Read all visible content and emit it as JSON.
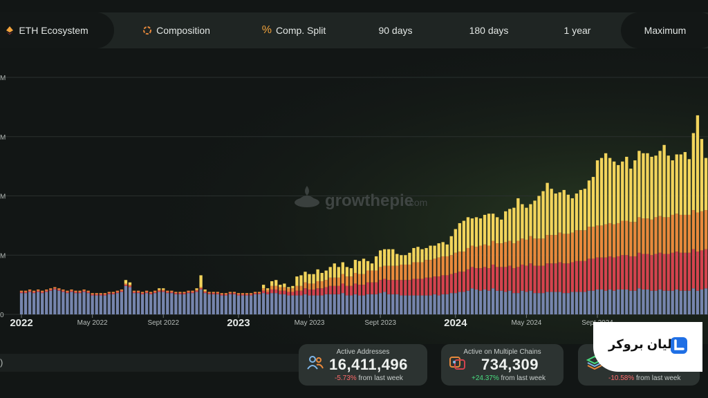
{
  "tabs": [
    {
      "label": "ETH Ecosystem",
      "icon": "eth-ecosystem-icon"
    },
    {
      "label": "Composition",
      "icon": "composition-icon"
    },
    {
      "label": "Comp. Split",
      "icon": "percent-icon"
    },
    {
      "label": "90 days"
    },
    {
      "label": "180 days"
    },
    {
      "label": "1 year"
    },
    {
      "label": "Maximum",
      "active": true
    }
  ],
  "watermark": {
    "text": "growthepie",
    "suffix": ".com",
    "icon": "pie-logo-icon"
  },
  "stats": [
    {
      "title": "Active Addresses",
      "value": "16,411,496",
      "change": "-5.73%",
      "direction": "down",
      "suffix": "from last week",
      "icon": "users-icon"
    },
    {
      "title": "Active on Multiple Chains",
      "value": "734,309",
      "change": "+24.37%",
      "direction": "up",
      "suffix": "from last week",
      "icon": "chains-icon"
    },
    {
      "title": "",
      "value": "",
      "change": "-10.58%",
      "direction": "down",
      "suffix": "from last week",
      "icon": "layers-icon"
    }
  ],
  "bottom_label": ")",
  "brand": {
    "label": "لیان بروکر",
    "icon": "brand-logo-icon"
  },
  "colors": {
    "accent_yellow": "#f2d45c",
    "mid_orange": "#e8893c",
    "red": "#d4434e",
    "blue_gray": "#7685ad",
    "background": "#121615",
    "up": "#4ade80",
    "down": "#ff6a6a"
  },
  "chart_data": {
    "type": "bar",
    "stacked": true,
    "y_tick_suffix": "M",
    "y_tick_labels": [
      "M",
      "M",
      "M",
      "M",
      "0"
    ],
    "ylim": [
      0,
      20
    ],
    "grid": true,
    "x_tick_labels": [
      "2022",
      "May 2022",
      "Sept 2022",
      "2023",
      "May 2023",
      "Sept 2023",
      "2024",
      "May 2024",
      "Sept 2024"
    ],
    "x_tick_bold": [
      "2022",
      "2023",
      "2024"
    ],
    "x_tick_index": [
      0,
      17,
      34,
      52,
      69,
      86,
      104,
      121,
      138
    ],
    "series": [
      {
        "color": "#7685ad",
        "values": [
          1.8,
          1.8,
          1.9,
          1.8,
          1.9,
          1.8,
          1.9,
          2.0,
          2.1,
          2.0,
          1.9,
          1.8,
          1.9,
          1.8,
          1.8,
          1.9,
          1.8,
          1.6,
          1.6,
          1.6,
          1.6,
          1.7,
          1.7,
          1.8,
          1.9,
          2.4,
          2.3,
          1.8,
          1.8,
          1.7,
          1.8,
          1.7,
          1.8,
          1.9,
          1.9,
          1.8,
          1.8,
          1.7,
          1.7,
          1.7,
          1.8,
          1.8,
          1.9,
          2.1,
          1.8,
          1.7,
          1.7,
          1.7,
          1.6,
          1.6,
          1.7,
          1.7,
          1.6,
          1.6,
          1.6,
          1.6,
          1.7,
          1.7,
          1.8,
          1.7,
          1.8,
          1.8,
          1.7,
          1.7,
          1.6,
          1.6,
          1.6,
          1.6,
          1.7,
          1.6,
          1.6,
          1.6,
          1.6,
          1.7,
          1.7,
          1.7,
          1.7,
          1.8,
          1.6,
          1.6,
          1.7,
          1.6,
          1.6,
          1.7,
          1.7,
          1.7,
          1.8,
          1.9,
          1.7,
          1.7,
          1.7,
          1.6,
          1.6,
          1.6,
          1.6,
          1.6,
          1.6,
          1.6,
          1.6,
          1.7,
          1.6,
          1.7,
          1.7,
          1.8,
          1.8,
          1.9,
          1.9,
          2.0,
          2.2,
          2.1,
          2.0,
          2.1,
          2.0,
          2.2,
          2.0,
          2.0,
          1.9,
          2.0,
          1.8,
          1.8,
          2.0,
          1.9,
          2.0,
          1.8,
          1.8,
          1.8,
          1.9,
          1.9,
          1.9,
          1.9,
          1.8,
          1.8,
          1.9,
          1.9,
          1.9,
          1.9,
          2.0,
          2.0,
          2.1,
          2.1,
          2.0,
          2.1,
          2.0,
          2.1,
          2.1,
          2.1,
          2.0,
          2.0,
          2.2,
          2.1,
          2.1,
          2.0,
          2.0,
          2.1,
          2.0,
          2.0,
          2.0,
          2.1,
          2.0,
          2.0,
          2.0,
          2.2,
          2.0,
          2.1,
          2.2
        ]
      },
      {
        "color": "#d4434e",
        "values": [
          0.1,
          0.1,
          0.1,
          0.1,
          0.1,
          0.1,
          0.1,
          0.1,
          0.1,
          0.1,
          0.1,
          0.1,
          0.1,
          0.1,
          0.1,
          0.1,
          0.1,
          0.1,
          0.1,
          0.1,
          0.1,
          0.1,
          0.1,
          0.1,
          0.1,
          0.1,
          0.1,
          0.1,
          0.1,
          0.1,
          0.1,
          0.1,
          0.1,
          0.1,
          0.1,
          0.1,
          0.1,
          0.1,
          0.1,
          0.1,
          0.1,
          0.1,
          0.1,
          0.1,
          0.1,
          0.1,
          0.1,
          0.1,
          0.1,
          0.1,
          0.1,
          0.1,
          0.1,
          0.1,
          0.1,
          0.1,
          0.1,
          0.1,
          0.2,
          0.2,
          0.3,
          0.3,
          0.3,
          0.3,
          0.3,
          0.3,
          0.4,
          0.4,
          0.5,
          0.5,
          0.5,
          0.6,
          0.6,
          0.6,
          0.7,
          0.7,
          0.7,
          0.8,
          0.8,
          0.8,
          0.9,
          0.9,
          0.9,
          1.0,
          1.0,
          1.0,
          1.1,
          1.1,
          1.2,
          1.2,
          1.2,
          1.3,
          1.3,
          1.3,
          1.4,
          1.4,
          1.4,
          1.5,
          1.5,
          1.5,
          1.6,
          1.6,
          1.6,
          1.6,
          1.7,
          1.7,
          1.7,
          1.8,
          1.8,
          1.8,
          1.9,
          1.9,
          1.9,
          2.0,
          2.0,
          2.0,
          2.1,
          2.1,
          2.1,
          2.2,
          2.2,
          2.2,
          2.3,
          2.3,
          2.3,
          2.3,
          2.4,
          2.4,
          2.4,
          2.5,
          2.5,
          2.5,
          2.5,
          2.6,
          2.6,
          2.6,
          2.7,
          2.7,
          2.7,
          2.7,
          2.8,
          2.8,
          2.8,
          2.8,
          2.9,
          2.9,
          2.9,
          2.9,
          3.0,
          3.0,
          3.0,
          3.0,
          3.1,
          3.1,
          3.1,
          3.1,
          3.2,
          3.2,
          3.2,
          3.2,
          3.2,
          3.3,
          3.3,
          3.3,
          3.3,
          3.4
        ]
      },
      {
        "color": "#e8893c",
        "values": [
          0.1,
          0.1,
          0.1,
          0.1,
          0.1,
          0.1,
          0.1,
          0.1,
          0.1,
          0.1,
          0.1,
          0.1,
          0.1,
          0.1,
          0.1,
          0.1,
          0.1,
          0.1,
          0.1,
          0.1,
          0.1,
          0.1,
          0.1,
          0.1,
          0.1,
          0.1,
          0.1,
          0.1,
          0.1,
          0.1,
          0.1,
          0.1,
          0.1,
          0.1,
          0.1,
          0.1,
          0.1,
          0.1,
          0.1,
          0.1,
          0.1,
          0.1,
          0.1,
          0.1,
          0.1,
          0.1,
          0.1,
          0.1,
          0.1,
          0.1,
          0.1,
          0.1,
          0.1,
          0.1,
          0.1,
          0.1,
          0.1,
          0.1,
          0.2,
          0.2,
          0.3,
          0.3,
          0.3,
          0.3,
          0.3,
          0.3,
          0.4,
          0.4,
          0.5,
          0.5,
          0.5,
          0.6,
          0.6,
          0.6,
          0.7,
          0.7,
          0.7,
          0.8,
          0.8,
          0.8,
          0.9,
          0.9,
          0.9,
          1.0,
          1.0,
          1.0,
          1.1,
          1.1,
          1.2,
          1.2,
          1.2,
          1.3,
          1.3,
          1.3,
          1.4,
          1.4,
          1.4,
          1.5,
          1.5,
          1.5,
          1.6,
          1.6,
          1.6,
          1.6,
          1.7,
          1.7,
          1.7,
          1.8,
          1.8,
          1.8,
          1.9,
          1.9,
          1.9,
          2.0,
          2.0,
          2.0,
          2.1,
          2.1,
          2.1,
          2.2,
          2.2,
          2.2,
          2.3,
          2.3,
          2.3,
          2.3,
          2.4,
          2.4,
          2.4,
          2.5,
          2.5,
          2.5,
          2.5,
          2.6,
          2.6,
          2.6,
          2.7,
          2.7,
          2.7,
          2.7,
          2.8,
          2.8,
          2.8,
          2.8,
          2.9,
          2.9,
          2.9,
          2.9,
          3.0,
          3.0,
          3.0,
          3.0,
          3.1,
          3.1,
          3.1,
          3.1,
          3.2,
          3.2,
          3.2,
          3.2,
          3.2,
          3.3,
          3.3,
          3.3,
          3.3,
          3.4
        ]
      },
      {
        "color": "#f2d45c",
        "values": [
          0.0,
          0.0,
          0.0,
          0.0,
          0.0,
          0.0,
          0.0,
          0.0,
          0.0,
          0.0,
          0.0,
          0.0,
          0.0,
          0.0,
          0.0,
          0.0,
          0.0,
          0.0,
          0.0,
          0.0,
          0.0,
          0.0,
          0.0,
          0.0,
          0.0,
          0.3,
          0.2,
          0.0,
          0.0,
          0.0,
          0.0,
          0.0,
          0.0,
          0.1,
          0.1,
          0.0,
          0.0,
          0.0,
          0.0,
          0.0,
          0.0,
          0.0,
          0.1,
          1.0,
          0.1,
          0.0,
          0.0,
          0.0,
          0.0,
          0.0,
          0.0,
          0.0,
          0.0,
          0.0,
          0.0,
          0.0,
          0.0,
          0.0,
          0.3,
          0.1,
          0.4,
          0.5,
          0.2,
          0.3,
          0.1,
          0.2,
          0.8,
          0.9,
          0.9,
          0.8,
          0.8,
          1.0,
          0.7,
          0.8,
          0.9,
          1.2,
          0.9,
          1.0,
          0.8,
          0.7,
          1.1,
          1.1,
          1.3,
          0.8,
          0.6,
          1.2,
          1.4,
          1.4,
          1.4,
          1.4,
          1.0,
          0.8,
          0.8,
          1.0,
          1.2,
          1.3,
          1.1,
          1.0,
          1.2,
          1.1,
          1.2,
          1.2,
          1.0,
          1.6,
          2.0,
          2.4,
          2.6,
          2.6,
          2.3,
          2.5,
          2.3,
          2.5,
          2.7,
          2.3,
          2.2,
          2.0,
          2.6,
          2.7,
          3.0,
          3.6,
          2.9,
          2.7,
          2.7,
          3.2,
          3.6,
          4.0,
          4.4,
          3.9,
          3.5,
          3.4,
          3.7,
          3.3,
          2.9,
          3.1,
          3.4,
          3.5,
          3.9,
          4.2,
          5.5,
          5.7,
          6.0,
          5.5,
          5.3,
          4.9,
          5.0,
          5.4,
          4.5,
          5.2,
          5.6,
          5.5,
          5.5,
          5.3,
          5.2,
          5.5,
          6.1,
          5.2,
          4.6,
          5.0,
          5.1,
          5.3,
          4.7,
          6.5,
          8.2,
          6.1,
          4.4,
          8.3,
          7.5,
          7.6,
          10.1
        ]
      }
    ]
  }
}
